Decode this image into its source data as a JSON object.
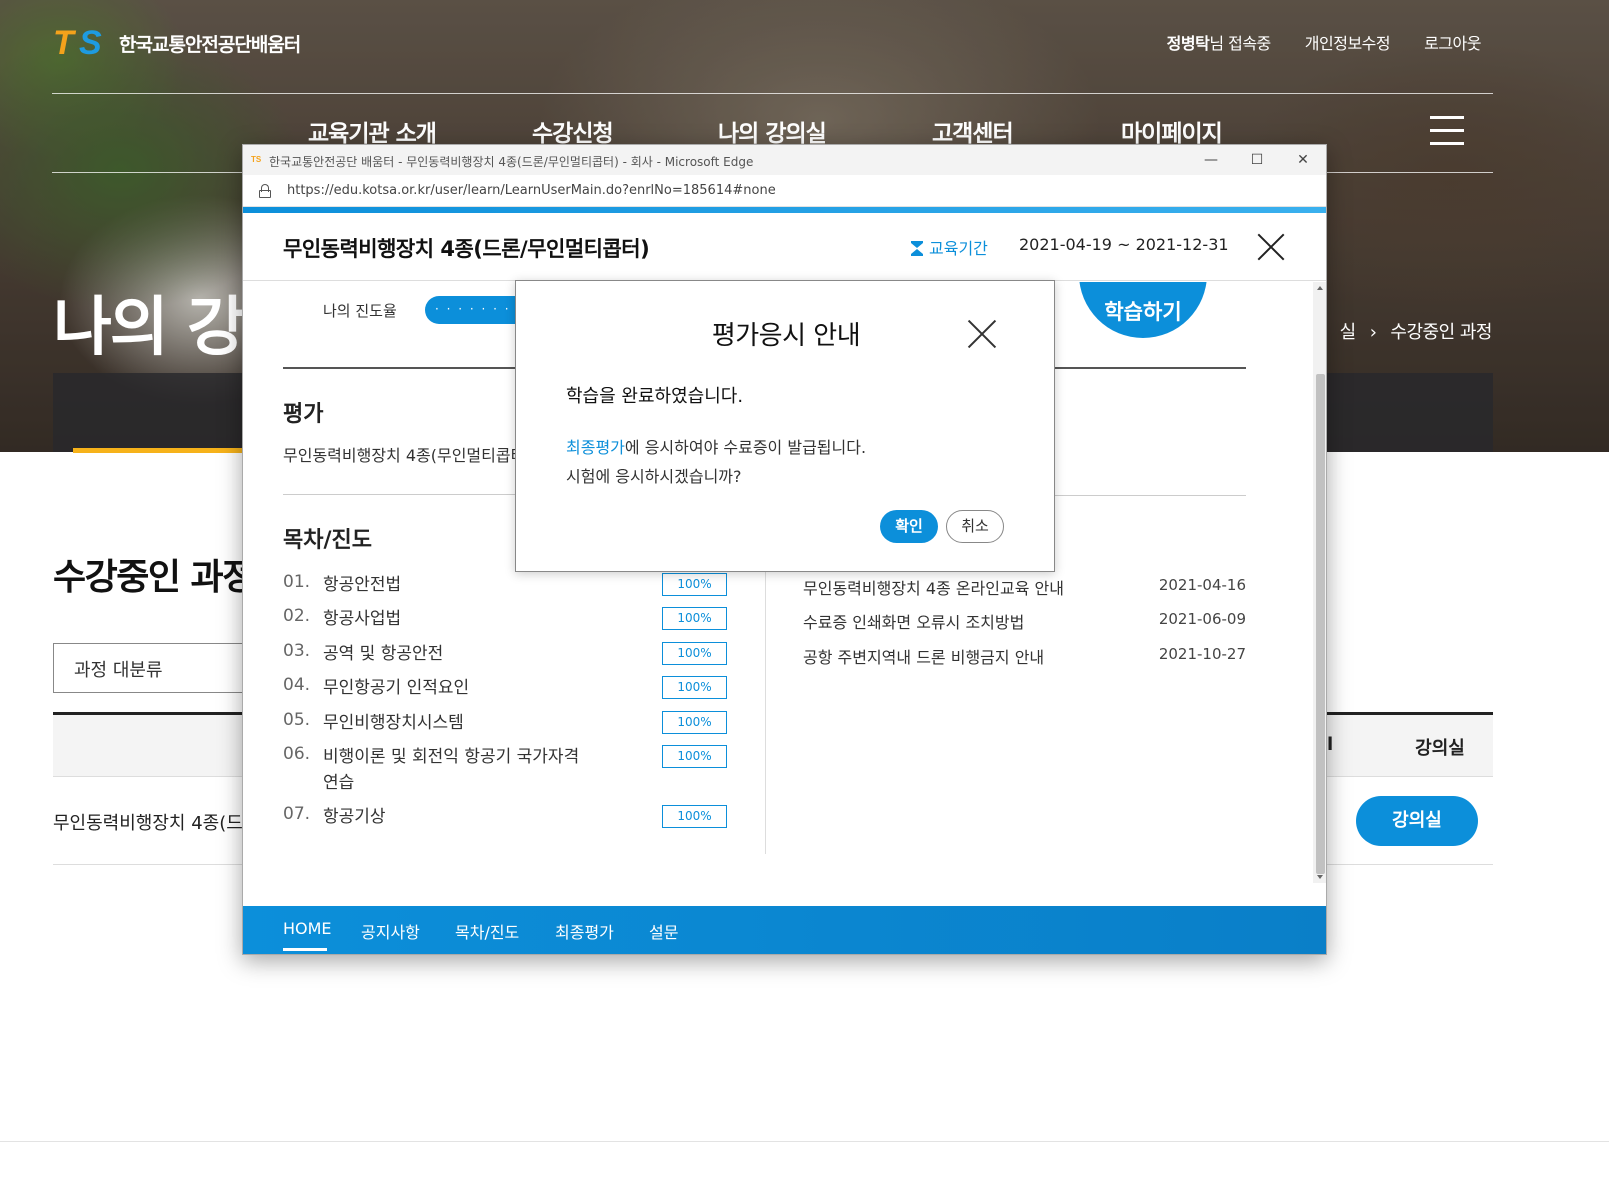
{
  "site": {
    "logo_mark_t": "T",
    "logo_mark_s": "S",
    "logo_text": "한국교통안전공단배움터",
    "user_name": "정병탁",
    "user_suffix": "님 접속중",
    "privacy_link": "개인정보수정",
    "logout_link": "로그아웃",
    "gnb": [
      "교육기관 소개",
      "수강신청",
      "나의 강의실",
      "고객센터",
      "마이페이지"
    ],
    "page_heading": "나의 강",
    "breadcrumb": {
      "partial": "실",
      "current": "수강중인 과정"
    },
    "section_title": "수강중인 과정",
    "filter_label": "과정 대분류",
    "table_header_cut": "l",
    "table_header_room": "강의실",
    "row_title": "무인동력비행장치 4종(드",
    "room_button": "강의실"
  },
  "window": {
    "title": "한국교통안전공단 배움터 - 무인동력비행장치 4종(드론/무인멀티콥터) - 회사 - Microsoft Edge",
    "icon": "TS",
    "url": "https://edu.kotsa.or.kr/user/learn/LearnUserMain.do?enrlNo=185614#none",
    "minimize": "—",
    "maximize": "☐",
    "close": "✕"
  },
  "course": {
    "title": "무인동력비행장치 4종(드론/무인멀티콥터)",
    "period_label": "교육기간",
    "period": "2021-04-19 ~ 2021-12-31",
    "progress_label": "나의 진도율",
    "progress_pill": "· · · · · · · · ·",
    "learn_button": "학습하기",
    "eval_title": "평가",
    "eval_course": "무인동력비행장치 4종(무인멀티콥터)",
    "toc_title": "목차/진도",
    "toc": [
      {
        "num": "01.",
        "name": "항공안전법",
        "pct": "100%"
      },
      {
        "num": "02.",
        "name": "항공사업법",
        "pct": "100%"
      },
      {
        "num": "03.",
        "name": "공역 및 항공안전",
        "pct": "100%"
      },
      {
        "num": "04.",
        "name": "무인항공기 인적요인",
        "pct": "100%"
      },
      {
        "num": "05.",
        "name": "무인비행장치시스템",
        "pct": "100%"
      },
      {
        "num": "06.",
        "name": "비행이론 및 회전익 항공기 국가자격연습",
        "pct": "100%"
      },
      {
        "num": "07.",
        "name": "항공기상",
        "pct": "100%"
      }
    ],
    "notices": [
      {
        "title": "무인동력비행장치 4종 온라인교육 안내",
        "date": "2021-04-16"
      },
      {
        "title": "수료증 인쇄화면 오류시 조치방법",
        "date": "2021-06-09"
      },
      {
        "title": "공항 주변지역내 드론 비행금지 안내",
        "date": "2021-10-27"
      }
    ],
    "nav": [
      "HOME",
      "공지사항",
      "목차/진도",
      "최종평가",
      "설문"
    ]
  },
  "dialog": {
    "title": "평가응시 안내",
    "line1": "학습을 완료하였습니다.",
    "link_text": "최종평가",
    "line2_rest": "에 응시하여야 수료증이 발급됩니다.",
    "line3": "시험에 응시하시겠습니까?",
    "ok": "확인",
    "cancel": "취소"
  },
  "colors": {
    "accent": "#0c8fda",
    "logo_orange": "#f4a21b",
    "tab_highlight": "#f6b21a"
  }
}
